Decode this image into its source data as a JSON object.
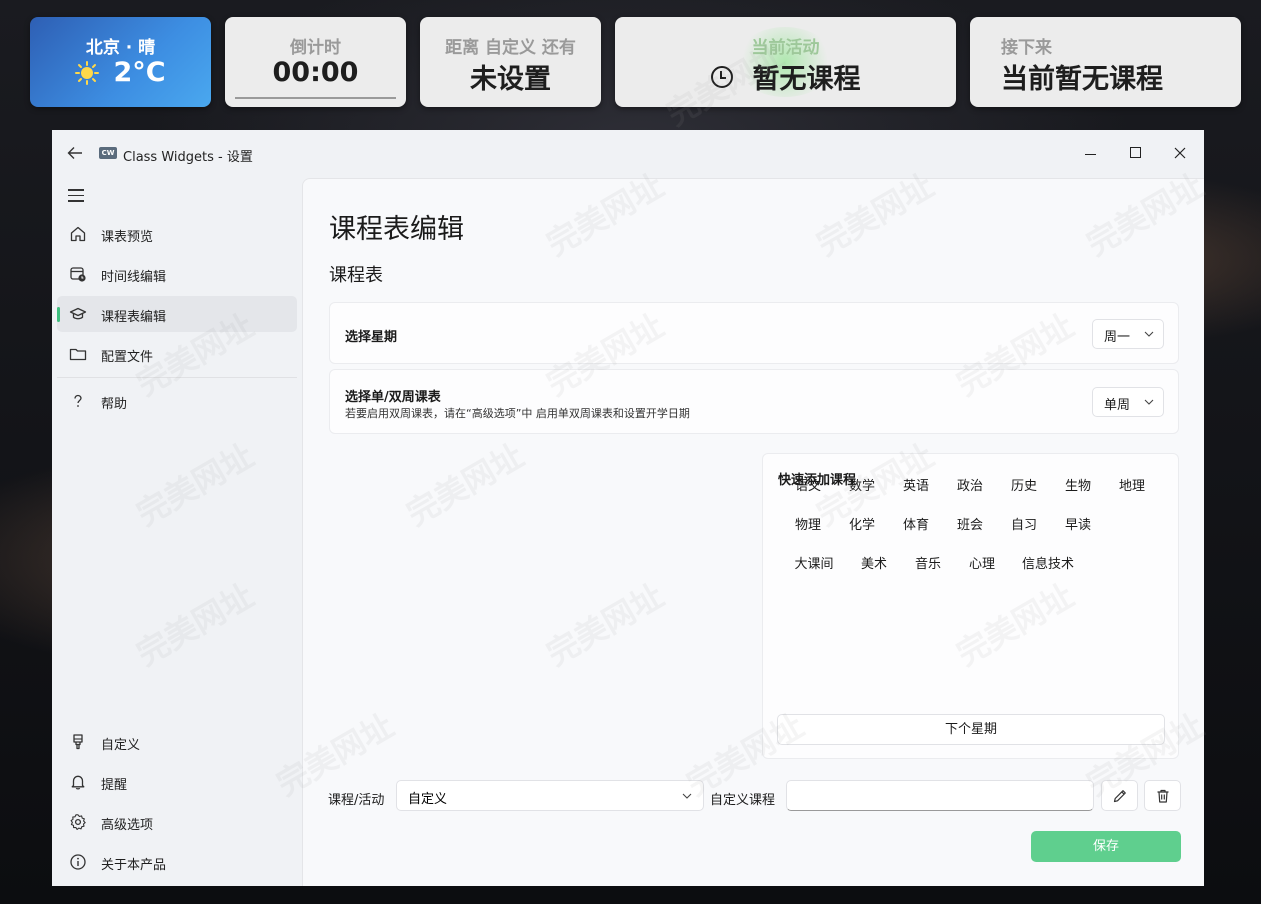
{
  "widgets": {
    "weather": {
      "title": "北京 · 晴",
      "temp": "2°C",
      "icon": "sun-icon"
    },
    "countdown": {
      "title": "倒计时",
      "value": "00:00"
    },
    "distance": {
      "title": "距离 自定义 还有",
      "value": "未设置"
    },
    "current": {
      "title": "当前活动",
      "value": "暂无课程",
      "icon": "clock-icon"
    },
    "next": {
      "title": "接下来",
      "value": "当前暂无课程"
    }
  },
  "window": {
    "title": "Class Widgets - 设置",
    "logo_text": "CW"
  },
  "nav": {
    "items": [
      {
        "label": "课表预览",
        "icon": "home-icon"
      },
      {
        "label": "时间线编辑",
        "icon": "calendar-clock-icon"
      },
      {
        "label": "课程表编辑",
        "icon": "graduation-cap-icon",
        "active": true
      },
      {
        "label": "配置文件",
        "icon": "folder-icon"
      },
      {
        "label": "帮助",
        "icon": "question-icon"
      }
    ],
    "bottom_items": [
      {
        "label": "自定义",
        "icon": "brush-icon"
      },
      {
        "label": "提醒",
        "icon": "bell-icon"
      },
      {
        "label": "高级选项",
        "icon": "gear-icon"
      },
      {
        "label": "关于本产品",
        "icon": "info-icon"
      }
    ]
  },
  "page": {
    "title": "课程表编辑",
    "section": "课程表",
    "weekday": {
      "label": "选择星期",
      "value": "周一"
    },
    "week_type": {
      "label": "选择单/双周课表",
      "description": "若要启用双周课表，请在“高级选项”中 启用单双周课表和设置开学日期",
      "value": "单周"
    },
    "quick_add": {
      "title": "快速添加课程",
      "rows": [
        [
          "语文",
          "数学",
          "英语",
          "政治",
          "历史",
          "生物",
          "地理"
        ],
        [
          "物理",
          "化学",
          "体育",
          "班会",
          "自习",
          "早读"
        ],
        [
          "大课间",
          "美术",
          "音乐",
          "心理",
          "信息技术"
        ]
      ],
      "next_week_label": "下个星期"
    },
    "course_label": "课程/活动",
    "course_value": "自定义",
    "custom_label": "自定义课程",
    "custom_value": "",
    "save_label": "保存"
  },
  "colors": {
    "accent": "#5fcf8e",
    "nav_indicator": "#3fbf7f",
    "weather_bg": "#3d8ee2"
  },
  "watermark": "完美网址"
}
